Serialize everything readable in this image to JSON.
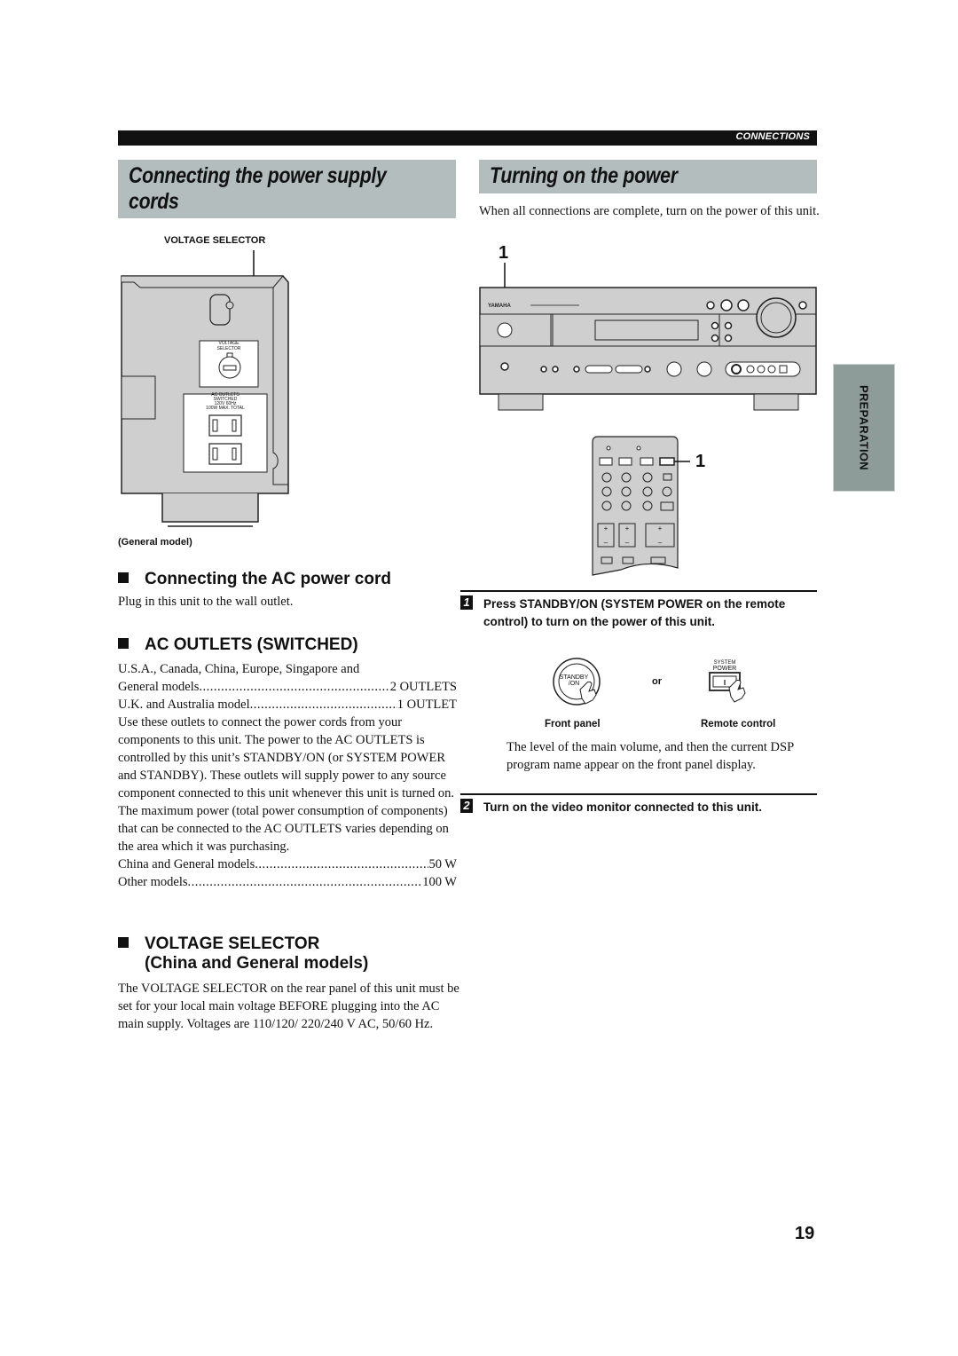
{
  "header": {
    "section_label": "CONNECTIONS"
  },
  "left": {
    "title": "Connecting the power supply cords",
    "title_line1": "Connecting the power supply",
    "title_line2": "cords",
    "figure": {
      "callout_label": "VOLTAGE SELECTOR",
      "panel_selector_label_1": "VOLTAGE",
      "panel_selector_label_2": "SELECTOR",
      "outlets_label_1": "AC OUTLETS",
      "outlets_label_2": "SWITCHED",
      "outlets_label_3": "120V 60Hz",
      "outlets_label_4": "100W MAX. TOTAL",
      "caption": "(General model)"
    },
    "ac_cord": {
      "heading": "Connecting the AC power cord",
      "text": "Plug in this unit to the wall outlet."
    },
    "ac_outlets": {
      "heading": "AC OUTLETS (SWITCHED)",
      "intro": "U.S.A., Canada, China, Europe, Singapore and",
      "rows": [
        {
          "label": "General models",
          "value": "2 OUTLETS"
        },
        {
          "label": "U.K. and Australia model",
          "value": "1 OUTLET"
        }
      ],
      "paragraph": "Use these outlets to connect the power cords from your components to this unit. The power to the AC OUTLETS is controlled by this unit’s STANDBY/ON (or SYSTEM POWER and STANDBY). These outlets will supply power to any source component connected to this unit whenever this unit is turned on. The maximum power (total power consumption of components) that can be connected to the AC OUTLETS varies depending on the area which it was purchasing.",
      "power_rows": [
        {
          "label": "China and General models",
          "value": "50 W"
        },
        {
          "label": "Other models",
          "value": "100 W"
        }
      ]
    },
    "voltage_selector": {
      "heading_line1": "VOLTAGE SELECTOR",
      "heading_line2": "(China and General models)",
      "paragraph": "The VOLTAGE SELECTOR on the rear panel of this unit must be set for your local main voltage BEFORE plugging into the AC main supply. Voltages are 110/120/ 220/240 V AC, 50/60 Hz."
    }
  },
  "right": {
    "title": "Turning on the power",
    "intro": "When all connections are complete, turn on the power of this unit.",
    "figure": {
      "callout_front": "1",
      "callout_remote": "1",
      "brand": "YAMAHA"
    },
    "steps": [
      {
        "number": "1",
        "text": "Press STANDBY/ON (SYSTEM POWER on the remote control) to turn on the power of this unit.",
        "illustration": {
          "front_button_label_1": "STANDBY",
          "front_button_label_2": "/ON",
          "or_label": "or",
          "remote_label_1": "SYSTEM",
          "remote_label_2": "POWER",
          "remote_button_glyph": "I",
          "caption_front": "Front panel",
          "caption_remote": "Remote control"
        },
        "note": "The level of the main volume, and then the current DSP program name appear on the front panel display."
      },
      {
        "number": "2",
        "text": "Turn on the video monitor connected to this unit."
      }
    ]
  },
  "side_tab": {
    "label": "PREPARATION"
  },
  "footer": {
    "page_number": "19"
  }
}
